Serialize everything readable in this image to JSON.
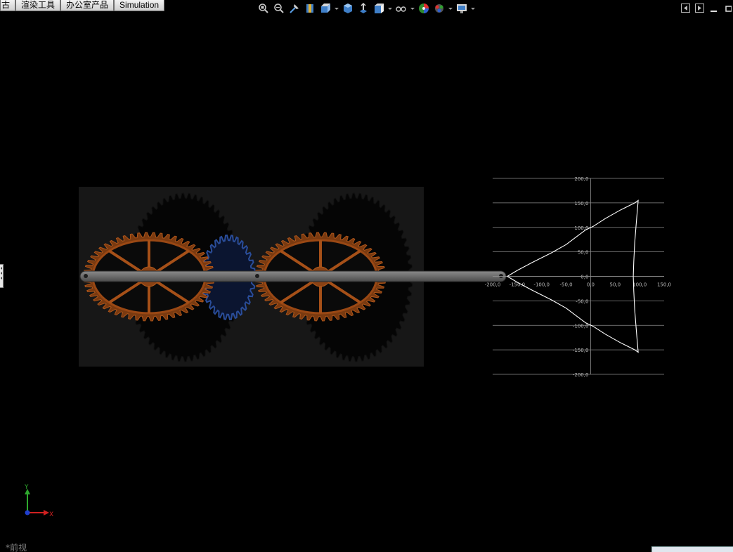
{
  "tabs": [
    "古",
    "渲染工具",
    "办公室产品",
    "Simulation"
  ],
  "hud_toolbar": {
    "icons": [
      "zoom-to-fit-icon",
      "zoom-to-area-icon",
      "previous-view-icon",
      "section-view-icon",
      "view-orientation-icon",
      "display-style-icon",
      "hide-show-items-icon",
      "edit-appearance-icon",
      "apply-scene-icon",
      "view-settings-icon"
    ]
  },
  "view_label": "*前视",
  "chart_data": {
    "type": "line",
    "title": "",
    "xlabel": "",
    "ylabel": "",
    "xlim": [
      -200,
      150
    ],
    "ylim": [
      -200,
      200
    ],
    "x_ticks": [
      "-200,0",
      "-150,0",
      "-100,0",
      "-50,0",
      "0,0",
      "50,0",
      "100,0",
      "150,0"
    ],
    "x_tick_values": [
      -200,
      -150,
      -100,
      -50,
      0,
      50,
      100,
      150
    ],
    "y_ticks": [
      "200,0",
      "150,0",
      "100,0",
      "50,0",
      "0,0",
      "-50,0",
      "-100,0",
      "-150,0",
      "-200,0"
    ],
    "y_tick_values": [
      200,
      150,
      100,
      50,
      0,
      -50,
      -100,
      -150,
      -200
    ],
    "grid": "horizontal",
    "series": [
      {
        "values": [
          [
            -170,
            0
          ],
          [
            -150,
            12
          ],
          [
            -120,
            28
          ],
          [
            -80,
            48
          ],
          [
            -50,
            65
          ],
          [
            -30,
            80
          ],
          [
            -10,
            95
          ],
          [
            5,
            102
          ],
          [
            30,
            118
          ],
          [
            60,
            135
          ],
          [
            90,
            150
          ],
          [
            97,
            155
          ],
          [
            94,
            120
          ],
          [
            90,
            70
          ],
          [
            88,
            30
          ],
          [
            87,
            0
          ],
          [
            88,
            -30
          ],
          [
            90,
            -70
          ],
          [
            94,
            -120
          ],
          [
            97,
            -155
          ],
          [
            90,
            -150
          ],
          [
            60,
            -135
          ],
          [
            30,
            -118
          ],
          [
            5,
            -102
          ],
          [
            -10,
            -95
          ],
          [
            -30,
            -80
          ],
          [
            -50,
            -65
          ],
          [
            -80,
            -48
          ],
          [
            -120,
            -28
          ],
          [
            -150,
            -12
          ],
          [
            -170,
            0
          ]
        ]
      }
    ]
  }
}
